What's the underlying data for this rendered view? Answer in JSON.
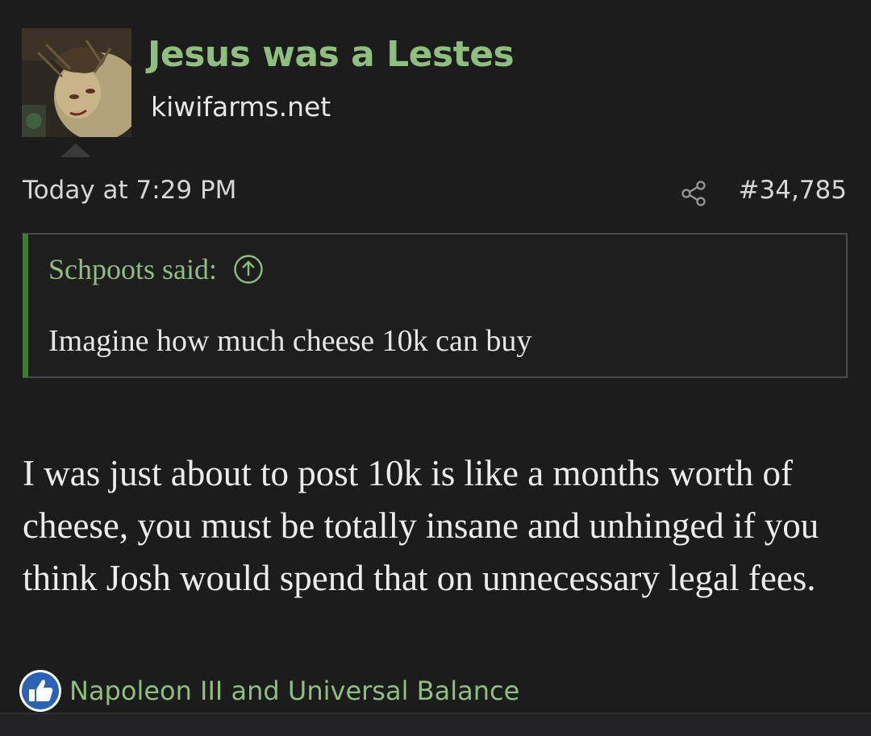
{
  "post": {
    "author": {
      "name": "Jesus was a Lestes",
      "site": "kiwifarms.net",
      "avatar_icon": "avatar-image"
    },
    "timestamp": "Today at 7:29 PM",
    "share_icon": "share-icon",
    "post_number": "#34,785",
    "quote": {
      "attribution": "Schpoots said:",
      "jump_icon": "arrow-up-circle-icon",
      "text": "Imagine how much cheese 10k can buy"
    },
    "body": "I was just about to post 10k is like a months worth of cheese, you must be totally insane and unhinged if you think Josh would spend that on unnecessary legal fees.",
    "reactions": {
      "icon": "like-icon",
      "text": "Napoleon III and Universal Balance"
    }
  },
  "colors": {
    "background": "#1c1c1d",
    "accent_green": "#8fbf7f",
    "quote_border": "#3f7a35",
    "text": "#e6e6e6",
    "like_blue": "#2a62b8"
  }
}
